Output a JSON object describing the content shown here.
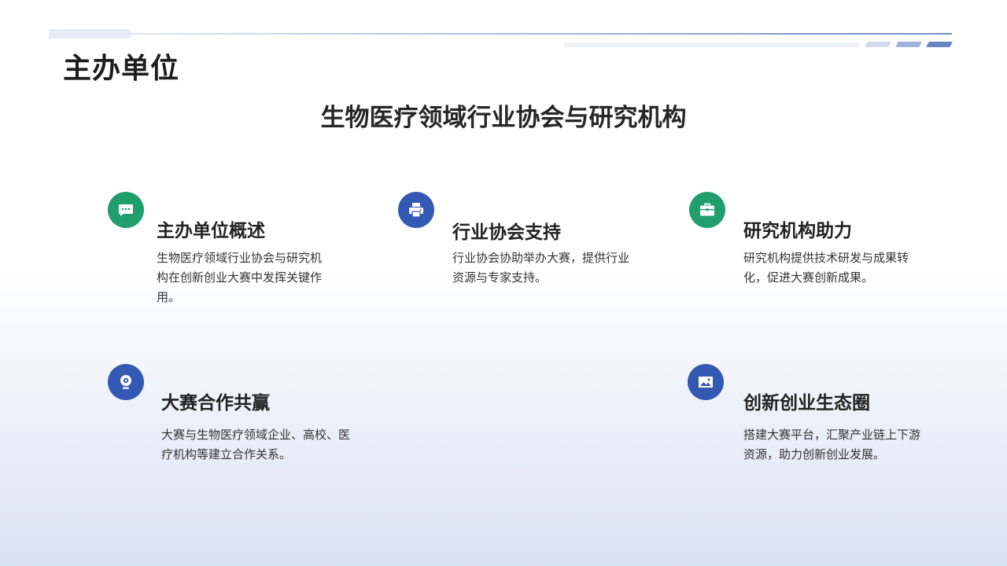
{
  "slide": {
    "title": "主办单位",
    "subtitle": "生物医疗领域行业协会与研究机构"
  },
  "cards": [
    {
      "icon": "chat-bubble-icon",
      "title": "主办单位概述",
      "text": "生物医疗领域行业协会与研究机构在创新创业大赛中发挥关键作用。"
    },
    {
      "icon": "printer-icon",
      "title": "行业协会支持",
      "text": "行业协会协助举办大赛，提供行业资源与专家支持。"
    },
    {
      "icon": "briefcase-icon",
      "title": "研究机构助力",
      "text": "研究机构提供技术研发与成果转化，促进大赛创新成果。"
    },
    {
      "icon": "webcam-icon",
      "title": "大赛合作共赢",
      "text": "大赛与生物医疗领域企业、高校、医疗机构等建立合作关系。"
    },
    {
      "icon": "image-icon",
      "title": "创新创业生态圈",
      "text": "搭建大赛平台，汇聚产业链上下游资源，助力创新创业发展。"
    }
  ],
  "colors": {
    "green": "#1f9e6e",
    "blue": "#3459b3",
    "accent_line": "#6f8cc7"
  }
}
